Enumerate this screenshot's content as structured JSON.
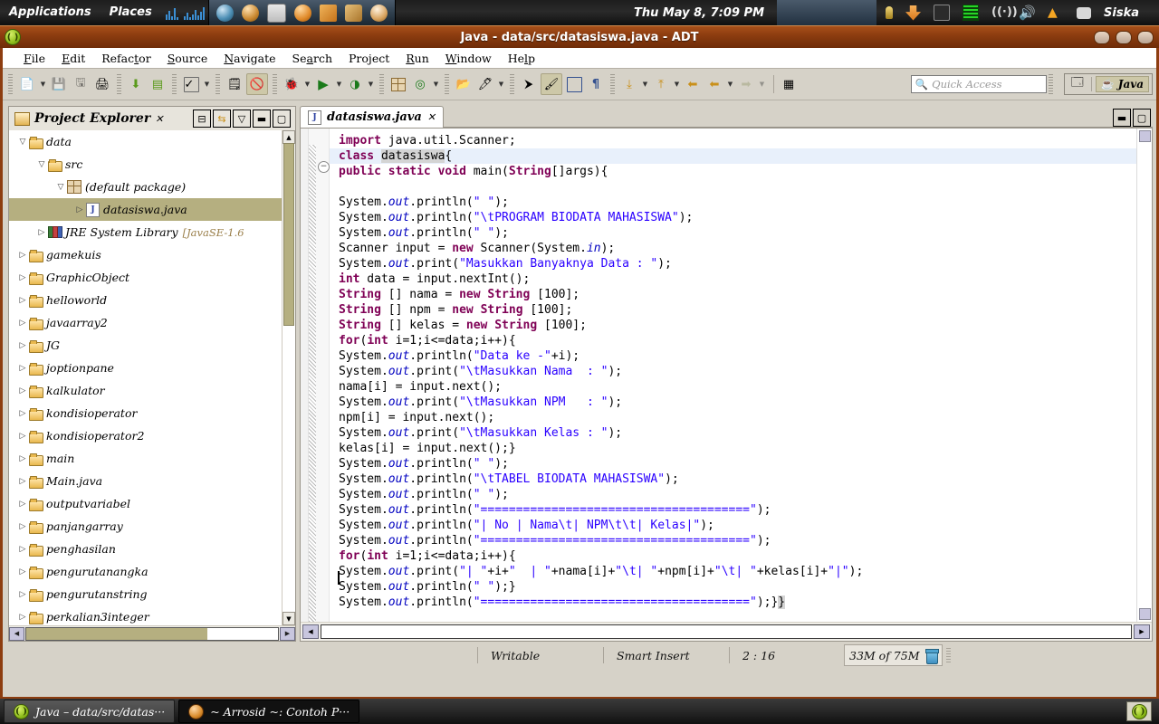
{
  "gnome_panel": {
    "menus": [
      "Applications",
      "Places"
    ],
    "launchers": [
      "chromium-icon",
      "egg-browser-icon",
      "virtualbox-icon",
      "help-icon",
      "xchat-icon",
      "tool-icon",
      "ubuntu-one-icon"
    ],
    "clock": "Thu May  8,  7:09 PM",
    "tray": [
      "bulb-icon",
      "update-manager-icon",
      "indicator-sound-apps-icon",
      "network-monitor-icon",
      "signal-icon",
      "volume-icon",
      "wifi-icon",
      "chat-icon"
    ],
    "user": "Siska"
  },
  "window": {
    "title": "Java - data/src/datasiswa.java - ADT",
    "app_icon": "eclipse-icon",
    "buttons": [
      "minimize",
      "maximize",
      "close"
    ]
  },
  "menubar": [
    {
      "label": "File",
      "accel": "F"
    },
    {
      "label": "Edit",
      "accel": "E"
    },
    {
      "label": "Refactor",
      "accel": "t"
    },
    {
      "label": "Source",
      "accel": "S"
    },
    {
      "label": "Navigate",
      "accel": "N"
    },
    {
      "label": "Search",
      "accel": "a"
    },
    {
      "label": "Project",
      "accel": "j"
    },
    {
      "label": "Run",
      "accel": "R"
    },
    {
      "label": "Window",
      "accel": "W"
    },
    {
      "label": "Help",
      "accel": "H"
    }
  ],
  "toolbar": {
    "groups": [
      [
        "new-wizard-icon",
        "dropdown",
        "save-icon",
        "save-all-icon",
        "print-icon"
      ],
      [
        "android-sdk-manager-icon",
        "android-avd-manager-icon"
      ],
      [
        "check-build-icon",
        "dropdown"
      ],
      [
        "new-java-class-icon",
        "skip-breakpoints-icon"
      ],
      [
        "debug-icon",
        "dropdown",
        "run-icon",
        "dropdown",
        "run-external-tools-icon",
        "dropdown"
      ],
      [
        "new-package-icon",
        "new-annotation-icon",
        "dropdown"
      ],
      [
        "open-type-icon",
        "open-task-icon",
        "dropdown"
      ],
      [
        "next-annotation-icon",
        "toggle-mark-occurrences-icon",
        "show-whitespace-icon",
        "pilcrow-icon"
      ],
      [
        "next-edit-icon",
        "dropdown",
        "previous-edit-icon",
        "dropdown",
        "back-icon",
        "forward-icon",
        "dropdown",
        "forward-history-icon",
        "dropdown"
      ],
      [
        "pin-editor-icon"
      ]
    ],
    "quick_access_placeholder": "Quick Access",
    "quick_access_value": "",
    "perspective_new_label": "open-perspective-icon",
    "perspective_active": "Java"
  },
  "project_explorer": {
    "title": "Project Explorer",
    "close_glyph": "✕",
    "header_buttons": [
      "collapse-all-icon",
      "link-with-editor-icon",
      "view-menu-icon",
      "minimize-icon",
      "maximize-icon"
    ],
    "tree": [
      {
        "label": "data",
        "icon": "project-folder",
        "depth": 0,
        "state": "open",
        "selected": false
      },
      {
        "label": "src",
        "icon": "source-folder",
        "depth": 1,
        "state": "open",
        "selected": false
      },
      {
        "label": "(default package)",
        "icon": "package",
        "depth": 2,
        "state": "open",
        "selected": false
      },
      {
        "label": "datasiswa.java",
        "icon": "java-file",
        "depth": 3,
        "state": "closed",
        "selected": true
      },
      {
        "label": "JRE System Library",
        "sub": "[JavaSE-1.6",
        "icon": "jre-library",
        "depth": 1,
        "state": "closed",
        "selected": false
      },
      {
        "label": "gamekuis",
        "icon": "project-folder-warn",
        "depth": 0,
        "state": "closed",
        "selected": false
      },
      {
        "label": "GraphicObject",
        "icon": "project-folder-warn",
        "depth": 0,
        "state": "closed",
        "selected": false
      },
      {
        "label": "helloworld",
        "icon": "project-folder",
        "depth": 0,
        "state": "closed",
        "selected": false
      },
      {
        "label": "javaarray2",
        "icon": "project-folder-warn",
        "depth": 0,
        "state": "closed",
        "selected": false
      },
      {
        "label": "JG",
        "icon": "project-folder-warn",
        "depth": 0,
        "state": "closed",
        "selected": false
      },
      {
        "label": "joptionpane",
        "icon": "project-folder",
        "depth": 0,
        "state": "closed",
        "selected": false
      },
      {
        "label": "kalkulator",
        "icon": "project-folder-warn",
        "depth": 0,
        "state": "closed",
        "selected": false
      },
      {
        "label": "kondisioperator",
        "icon": "project-folder",
        "depth": 0,
        "state": "closed",
        "selected": false
      },
      {
        "label": "kondisioperator2",
        "icon": "project-folder",
        "depth": 0,
        "state": "closed",
        "selected": false
      },
      {
        "label": "main",
        "icon": "project-folder",
        "depth": 0,
        "state": "closed",
        "selected": false
      },
      {
        "label": "Main.java",
        "icon": "project-folder-warn",
        "depth": 0,
        "state": "closed",
        "selected": false
      },
      {
        "label": "outputvariabel",
        "icon": "project-folder",
        "depth": 0,
        "state": "closed",
        "selected": false
      },
      {
        "label": "panjangarray",
        "icon": "project-folder",
        "depth": 0,
        "state": "closed",
        "selected": false
      },
      {
        "label": "penghasilan",
        "icon": "project-folder-warn",
        "depth": 0,
        "state": "closed",
        "selected": false
      },
      {
        "label": "pengurutanangka",
        "icon": "project-folder-warn",
        "depth": 0,
        "state": "closed",
        "selected": false
      },
      {
        "label": "pengurutanstring",
        "icon": "project-folder",
        "depth": 0,
        "state": "closed",
        "selected": false
      },
      {
        "label": "perkalian3integer",
        "icon": "project-folder",
        "depth": 0,
        "state": "closed",
        "selected": false
      }
    ]
  },
  "editor": {
    "tab_label": "datasiswa.java",
    "tab_icon": "java-file-icon",
    "tab_close": "✕",
    "header_buttons": [
      "minimize-icon",
      "maximize-icon"
    ],
    "file_name": "datasiswa.java",
    "code_lines": [
      "import java.util.Scanner;",
      "class datasiswa{",
      "public static void main(String[]args){",
      "",
      "System.out.println(\" \");",
      "System.out.println(\"\\tPROGRAM BIODATA MAHASISWA\");",
      "System.out.println(\" \");",
      "Scanner input = new Scanner(System.in);",
      "System.out.print(\"Masukkan Banyaknya Data : \");",
      "int data = input.nextInt();",
      "String [] nama = new String [100];",
      "String [] npm = new String [100];",
      "String [] kelas = new String [100];",
      "for(int i=1;i<=data;i++){",
      "System.out.println(\"Data ke -\"+i);",
      "System.out.print(\"\\tMasukkan Nama  : \");",
      "nama[i] = input.next();",
      "System.out.print(\"\\tMasukkan NPM   : \");",
      "npm[i] = input.next();",
      "System.out.print(\"\\tMasukkan Kelas : \");",
      "kelas[i] = input.next();}",
      "System.out.println(\" \");",
      "System.out.println(\"\\tTABEL BIODATA MAHASISWA\");",
      "System.out.println(\" \");",
      "System.out.println(\"======================================\");",
      "System.out.println(\"| No | Nama\\t| NPM\\t\\t| Kelas|\");",
      "System.out.println(\"======================================\");",
      "for(int i=1;i<=data;i++){",
      "System.out.print(\"| \"+i+\"  | \"+nama[i]+\"\\t| \"+npm[i]+\"\\t| \"+kelas[i]+\"|\");",
      "System.out.println(\" \");}",
      "System.out.println(\"======================================\");}}"
    ]
  },
  "statusbar": {
    "writable": "Writable",
    "insert_mode": "Smart Insert",
    "position": "2 : 16",
    "memory": "33M of 75M",
    "trash_icon": "trash-icon"
  },
  "taskbar": {
    "items": [
      {
        "label": "Java – data/src/datas···",
        "icon": "eclipse-icon",
        "active": true
      },
      {
        "label": "~ Arrosid ~: Contoh P···",
        "icon": "terminal-icon",
        "active": false
      }
    ],
    "tray_icon": "eclipse-icon"
  }
}
